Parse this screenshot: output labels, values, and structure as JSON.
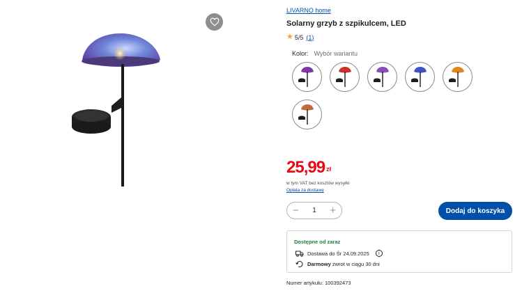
{
  "brand": "LIVARNO home",
  "title": "Solarny grzyb z szpikulcem, LED",
  "rating": {
    "score": "5/5",
    "count": "(1)",
    "stars": 1
  },
  "color": {
    "label": "Kolor:",
    "value": "Wybór wariantu"
  },
  "variants": [
    {
      "name": "variant-purple",
      "cap": "#7b3aa8"
    },
    {
      "name": "variant-red-dots",
      "cap": "#c8322a"
    },
    {
      "name": "variant-lilac",
      "cap": "#8a4cb5"
    },
    {
      "name": "variant-blue",
      "cap": "#3d54c4"
    },
    {
      "name": "variant-amber",
      "cap": "#d88a1c"
    },
    {
      "name": "variant-copper",
      "cap": "#c26a3a"
    }
  ],
  "price": {
    "amount": "25,99",
    "currency": "zł"
  },
  "vat_text": "w tym VAT bez kosztów wysyłki",
  "shipping_link": "Opłata za dostawę",
  "quantity": {
    "minus": "−",
    "value": "1",
    "plus": "+"
  },
  "add_to_cart": "Dodaj do koszyka",
  "availability": {
    "title": "Dostępne od zaraz",
    "delivery": "Dostawa do Śr 24.09.2025",
    "returns_bold": "Darmowy",
    "returns_rest": "zwrot w ciągu 30 dni"
  },
  "article_number": "Numer artykułu: 100392473",
  "icons": [
    "heart-icon",
    "star-icon",
    "delivery-truck-icon",
    "return-icon",
    "info-icon"
  ],
  "colors": {
    "accent": "#0050aa",
    "price": "#e60a14",
    "available": "#1a7f3c"
  }
}
